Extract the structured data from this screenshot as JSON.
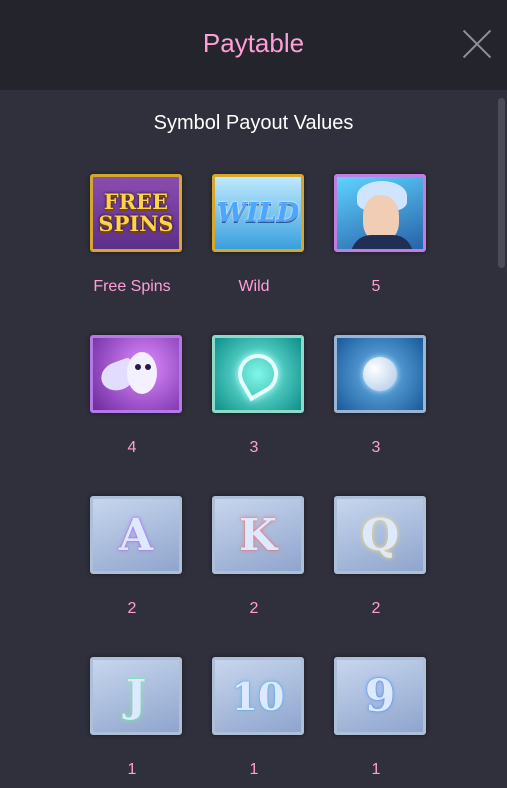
{
  "header": {
    "title": "Paytable"
  },
  "section": {
    "title": "Symbol Payout Values"
  },
  "symbols": [
    {
      "name": "Free Spins",
      "tile_text": "FREE\nSPINS",
      "label": "Free Spins"
    },
    {
      "name": "Wild",
      "tile_text": "WILD",
      "label": "Wild"
    },
    {
      "name": "hero",
      "label": "5"
    },
    {
      "name": "owl",
      "label": "4"
    },
    {
      "name": "gem",
      "label": "3"
    },
    {
      "name": "snowball",
      "label": "3"
    },
    {
      "name": "A",
      "tile_text": "A",
      "label": "2"
    },
    {
      "name": "K",
      "tile_text": "K",
      "label": "2"
    },
    {
      "name": "Q",
      "tile_text": "Q",
      "label": "2"
    },
    {
      "name": "J",
      "tile_text": "J",
      "label": "1"
    },
    {
      "name": "10",
      "tile_text": "10",
      "label": "1"
    },
    {
      "name": "9",
      "tile_text": "9",
      "label": "1"
    }
  ],
  "colors": {
    "accent": "#ff9fd8",
    "header_bg": "#24242d",
    "content_bg": "#30303c"
  }
}
